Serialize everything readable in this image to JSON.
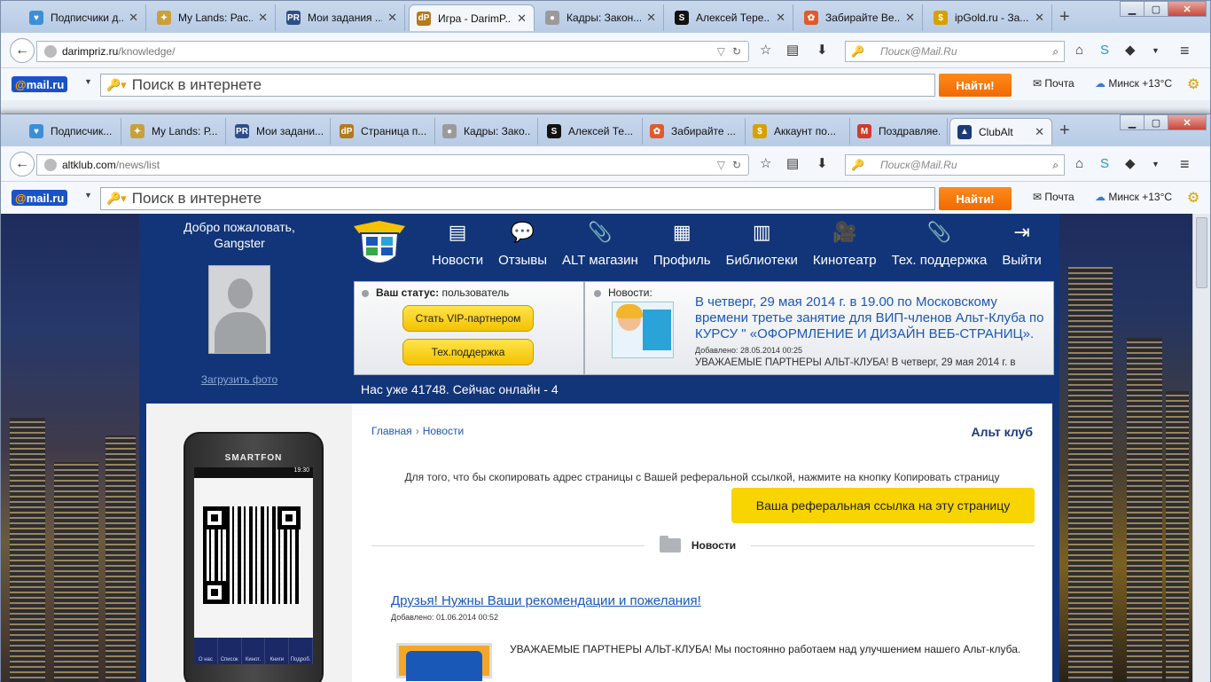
{
  "window_back": {
    "tabs": [
      {
        "label": "Подписчики д...",
        "icon_color": "#3b8fd8",
        "icon": "heart-icon"
      },
      {
        "label": "My Lands: Рас...",
        "icon_color": "#c9a03a",
        "icon": "mylands-icon"
      },
      {
        "label": "Мои задания ...",
        "icon_color": "#2d4e8a",
        "icon": "pr-icon"
      },
      {
        "label": "Игра - DarimP...",
        "icon_color": "#b57a1a",
        "icon": "dp-icon",
        "active": true
      },
      {
        "label": "Кадры: Закон...",
        "icon_color": "#9a9a9a",
        "icon": "film-icon"
      },
      {
        "label": "Алексей Тере...",
        "icon_color": "#111111",
        "icon": "s-icon"
      },
      {
        "label": "Забирайте Ве...",
        "icon_color": "#e25a2a",
        "icon": "flower-icon"
      },
      {
        "label": "ipGold.ru - За...",
        "icon_color": "#d8a000",
        "icon": "coin-icon"
      }
    ],
    "url_host": "darimpriz.ru",
    "url_path": "/knowledge/",
    "search_placeholder": "Поиск@Mail.Ru"
  },
  "window_front": {
    "tabs": [
      {
        "label": "Подписчик...",
        "icon_color": "#3b8fd8",
        "icon": "heart-icon"
      },
      {
        "label": "My Lands: Р...",
        "icon_color": "#c9a03a",
        "icon": "mylands-icon"
      },
      {
        "label": "Мои задани...",
        "icon_color": "#2d4e8a",
        "icon": "pr-icon"
      },
      {
        "label": "Страница п...",
        "icon_color": "#b57a1a",
        "icon": "dp-icon"
      },
      {
        "label": "Кадры: Зако...",
        "icon_color": "#9a9a9a",
        "icon": "film-icon"
      },
      {
        "label": "Алексей Те...",
        "icon_color": "#111111",
        "icon": "s-icon"
      },
      {
        "label": "Забирайте ...",
        "icon_color": "#e25a2a",
        "icon": "flower-icon"
      },
      {
        "label": "Аккаунт по...",
        "icon_color": "#d8a000",
        "icon": "coin-icon"
      },
      {
        "label": "Поздравляе...",
        "icon_color": "#d23a2a",
        "icon": "gmail-icon"
      },
      {
        "label": "ClubAlt",
        "icon_color": "#1a3a78",
        "icon": "clubalt-icon",
        "active": true
      }
    ],
    "url_host": "altklub.com",
    "url_path": "/news/list",
    "search_placeholder": "Поиск@Mail.Ru"
  },
  "mailbar": {
    "logo_at": "@",
    "logo_text": "mail.ru",
    "search_placeholder": "Поиск в интернете",
    "find_label": "Найти!",
    "mail_label": "Почта",
    "weather_label": "Минск +13°C"
  },
  "site": {
    "welcome_line1": "Добро пожаловать,",
    "welcome_line2": "Gangster",
    "upload_photo": "Загрузить фото",
    "menu": [
      {
        "label": "Новости",
        "icon": "news-icon",
        "glyph": "▤"
      },
      {
        "label": "Отзывы",
        "icon": "speech-bubble-icon",
        "glyph": "💬"
      },
      {
        "label": "ALT магазин",
        "icon": "paperclip-icon",
        "glyph": "📎"
      },
      {
        "label": "Профиль",
        "icon": "profile-card-icon",
        "glyph": "▦"
      },
      {
        "label": "Библиотеки",
        "icon": "library-icon",
        "glyph": "▥"
      },
      {
        "label": "Кинотеатр",
        "icon": "camera-icon",
        "glyph": "🎥"
      },
      {
        "label": "Тех. поддержка",
        "icon": "paperclip-icon",
        "glyph": "📎"
      },
      {
        "label": "Выйти",
        "icon": "exit-icon",
        "glyph": "⇥"
      }
    ],
    "status_label": "Ваш статус:",
    "status_value": "пользователь",
    "vip_button": "Стать VIP-партнером",
    "support_button": "Тех.поддержка",
    "news_label": "Новости:",
    "news_title": "В четверг, 29 мая 2014 г. в 19.00 по Московскому времени третье занятие для ВИП-членов Альт-Клуба по КУРСУ \" «ОФОРМЛЕНИЕ И ДИЗАЙН ВЕБ-СТРАНИЦ».",
    "news_date": "Добавлено: 28.05.2014 00:25",
    "news_text": "УВАЖАЕМЫЕ ПАРТНЕРЫ АЛЬТ-КЛУБА! В четверг, 29 мая 2014 г. в",
    "online_text": "Нас уже 41748. Сейчас онлайн - 4",
    "phone_brand": "SMARTFON",
    "phone_time": "19:30",
    "phone_apps": [
      "О нас",
      "Список",
      "Кинот.",
      "Книги",
      "Подроб."
    ],
    "breadcrumb_home": "Главная",
    "breadcrumb_current": "Новости",
    "club_name": "Альт клуб",
    "referral_info": "Для того, что бы скопировать адрес страницы с Вашей реферальной ссылкой, нажмите на кнопку Копировать страницу",
    "referral_button": "Ваша реферальная ссылка на эту страницу",
    "section_title": "Новости",
    "post_title": "Друзья! Нужны Ваши рекомендации и пожелания!",
    "post_date": "Добавлено: 01.06.2014 00:52",
    "post_text": "УВАЖАЕМЫЕ ПАРТНЕРЫ АЛЬТ-КЛУБА! Мы постоянно работаем над улучшением нашего Альт-клуба."
  },
  "colors": {
    "site_blue": "#123579",
    "link_blue": "#1a58b8",
    "yellow_button": "#f8d400",
    "mail_orange": "#f06a00"
  }
}
